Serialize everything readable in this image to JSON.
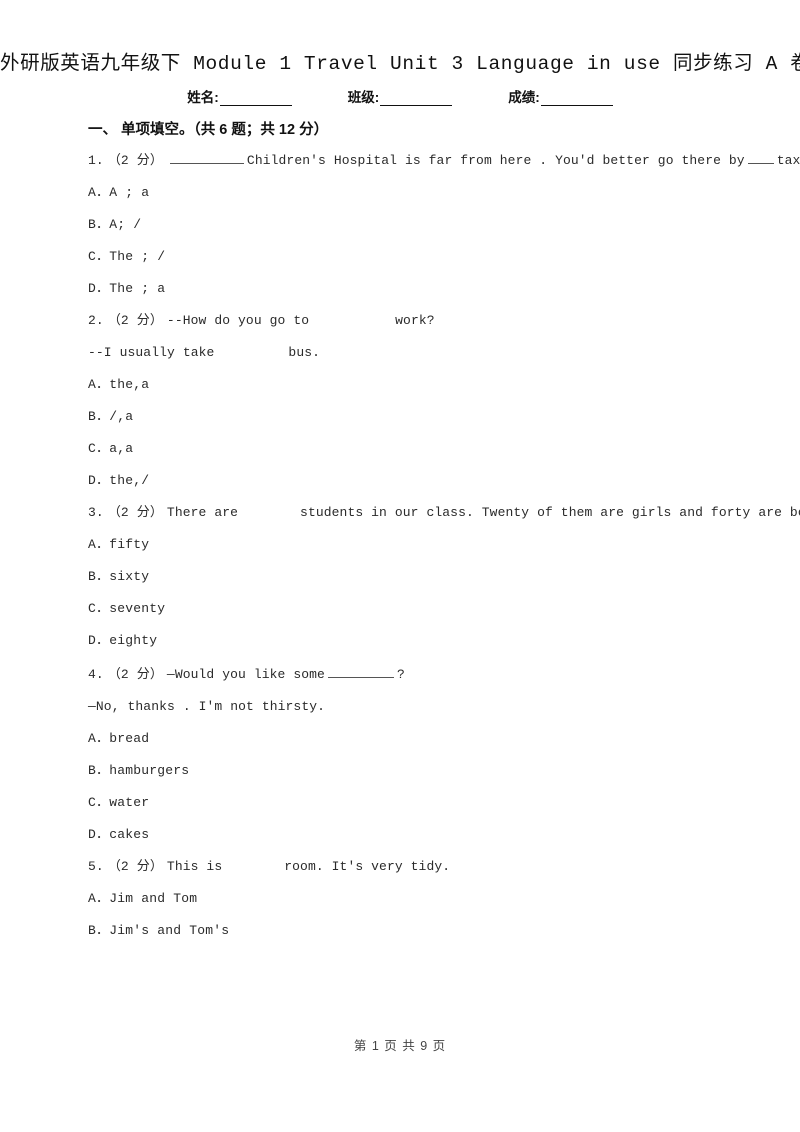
{
  "header": {
    "title": "外研版英语九年级下 Module 1 Travel Unit 3 Language in use 同步练习 A 卷",
    "fields": [
      {
        "label": "姓名:"
      },
      {
        "label": "班级:"
      },
      {
        "label": "成绩:"
      }
    ]
  },
  "section": {
    "heading": "一、 单项填空。（共 6 题；共 12 分）"
  },
  "questions": [
    {
      "number": "1.",
      "marks": "（2 分）",
      "stem_before": "",
      "stem_after": "Children's Hospital is far from here . You'd better go there by",
      "stem_tail": "taxi.",
      "continuation": "",
      "options": [
        {
          "letter": "A．",
          "text": "A ; a"
        },
        {
          "letter": "B．",
          "text": "A; /"
        },
        {
          "letter": "C．",
          "text": "The ; /"
        },
        {
          "letter": "D．",
          "text": "The ; a"
        }
      ]
    },
    {
      "number": "2.",
      "marks": "（2 分）",
      "stem_before": "--How do you go to",
      "stem_after": "work?",
      "continuation_before": "--I usually take",
      "continuation_after": "bus.",
      "options": [
        {
          "letter": "A．",
          "text": "the,a"
        },
        {
          "letter": "B．",
          "text": "/,a"
        },
        {
          "letter": "C．",
          "text": "a,a"
        },
        {
          "letter": "D．",
          "text": "the,/"
        }
      ]
    },
    {
      "number": "3.",
      "marks": "（2 分）",
      "stem_before": "There are",
      "stem_after": "students in our class. Twenty of them are girls and forty are boys.",
      "options": [
        {
          "letter": "A．",
          "text": "fifty"
        },
        {
          "letter": "B．",
          "text": "sixty"
        },
        {
          "letter": "C．",
          "text": "seventy"
        },
        {
          "letter": "D．",
          "text": "eighty"
        }
      ]
    },
    {
      "number": "4.",
      "marks": "（2 分）",
      "stem_before": "—Would you like some",
      "stem_after": "?",
      "continuation": "—No, thanks . I'm not thirsty.",
      "options": [
        {
          "letter": "A．",
          "text": "bread"
        },
        {
          "letter": "B．",
          "text": "hamburgers"
        },
        {
          "letter": "C．",
          "text": "water"
        },
        {
          "letter": "D．",
          "text": "cakes"
        }
      ]
    },
    {
      "number": "5.",
      "marks": "（2 分）",
      "stem_before": "This is",
      "stem_after": "room. It's very tidy.",
      "options": [
        {
          "letter": "A．",
          "text": "Jim and Tom"
        },
        {
          "letter": "B．",
          "text": "Jim's and Tom's"
        }
      ]
    }
  ],
  "footer": {
    "text": "第 1 页 共 9 页"
  }
}
